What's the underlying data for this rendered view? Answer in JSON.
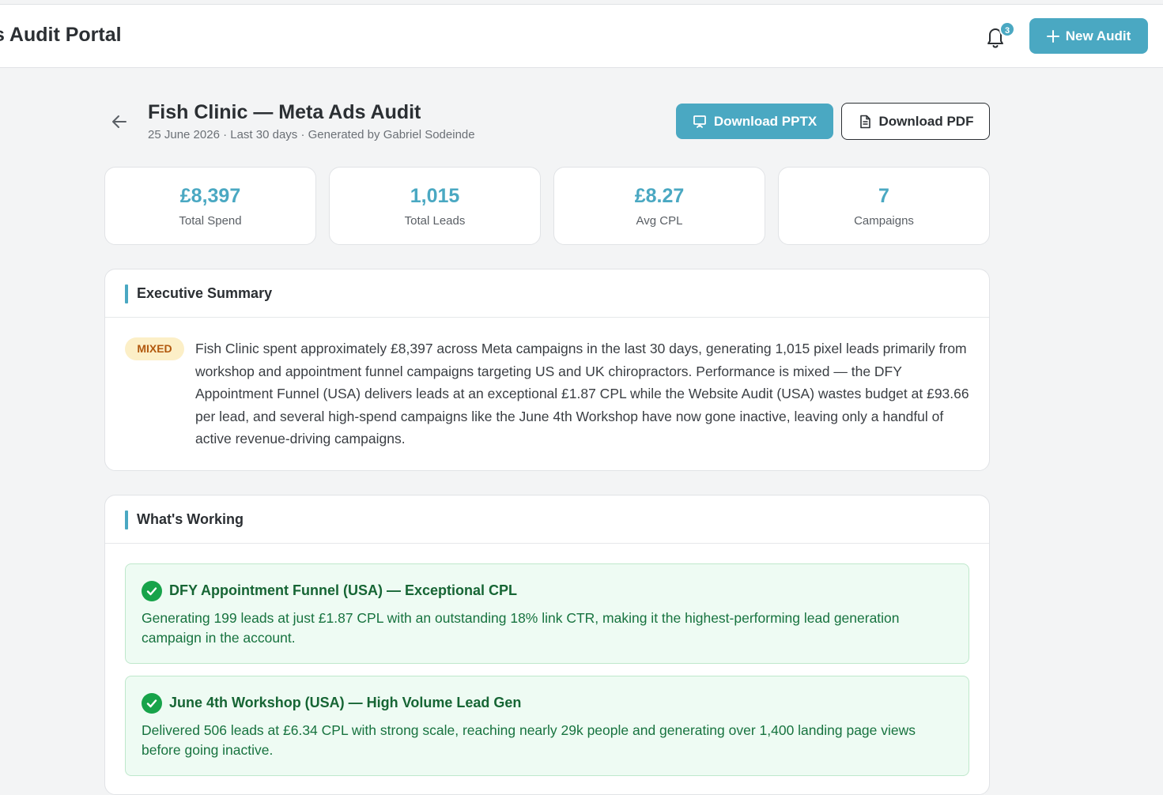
{
  "app": {
    "title": "s Audit Portal",
    "notification_count": "3",
    "new_audit_label": "New Audit"
  },
  "report": {
    "title": "Fish Clinic — Meta Ads Audit",
    "subtitle": "25 June 2026 · Last 30 days · Generated by Gabriel Sodeinde",
    "download_pptx_label": "Download PPTX",
    "download_pdf_label": "Download PDF"
  },
  "stats": [
    {
      "value": "£8,397",
      "label": "Total Spend"
    },
    {
      "value": "1,015",
      "label": "Total Leads"
    },
    {
      "value": "£8.27",
      "label": "Avg CPL"
    },
    {
      "value": "7",
      "label": "Campaigns"
    }
  ],
  "executive_summary": {
    "heading": "Executive Summary",
    "badge": "MIXED",
    "text": "Fish Clinic spent approximately £8,397 across Meta campaigns in the last 30 days, generating 1,015 pixel leads primarily from workshop and appointment funnel campaigns targeting US and UK chiropractors. Performance is mixed — the DFY Appointment Funnel (USA) delivers leads at an exceptional £1.87 CPL while the Website Audit (USA) wastes budget at £93.66 per lead, and several high-spend campaigns like the June 4th Workshop have now gone inactive, leaving only a handful of active revenue-driving campaigns."
  },
  "whats_working": {
    "heading": "What's Working",
    "items": [
      {
        "title": "DFY Appointment Funnel (USA) — Exceptional CPL",
        "body": "Generating 199 leads at just £1.87 CPL with an outstanding 18% link CTR, making it the highest-performing lead generation campaign in the account."
      },
      {
        "title": "June 4th Workshop (USA) — High Volume Lead Gen",
        "body": "Delivered 506 leads at £6.34 CPL with strong scale, reaching nearly 29k people and generating over 1,400 landing page views before going inactive."
      }
    ]
  },
  "colors": {
    "accent": "#4aa8c2",
    "success": "#17a34a",
    "success_bg": "#eefbf3",
    "warning_bg": "#fcefc7",
    "warning_text": "#b2590e"
  }
}
